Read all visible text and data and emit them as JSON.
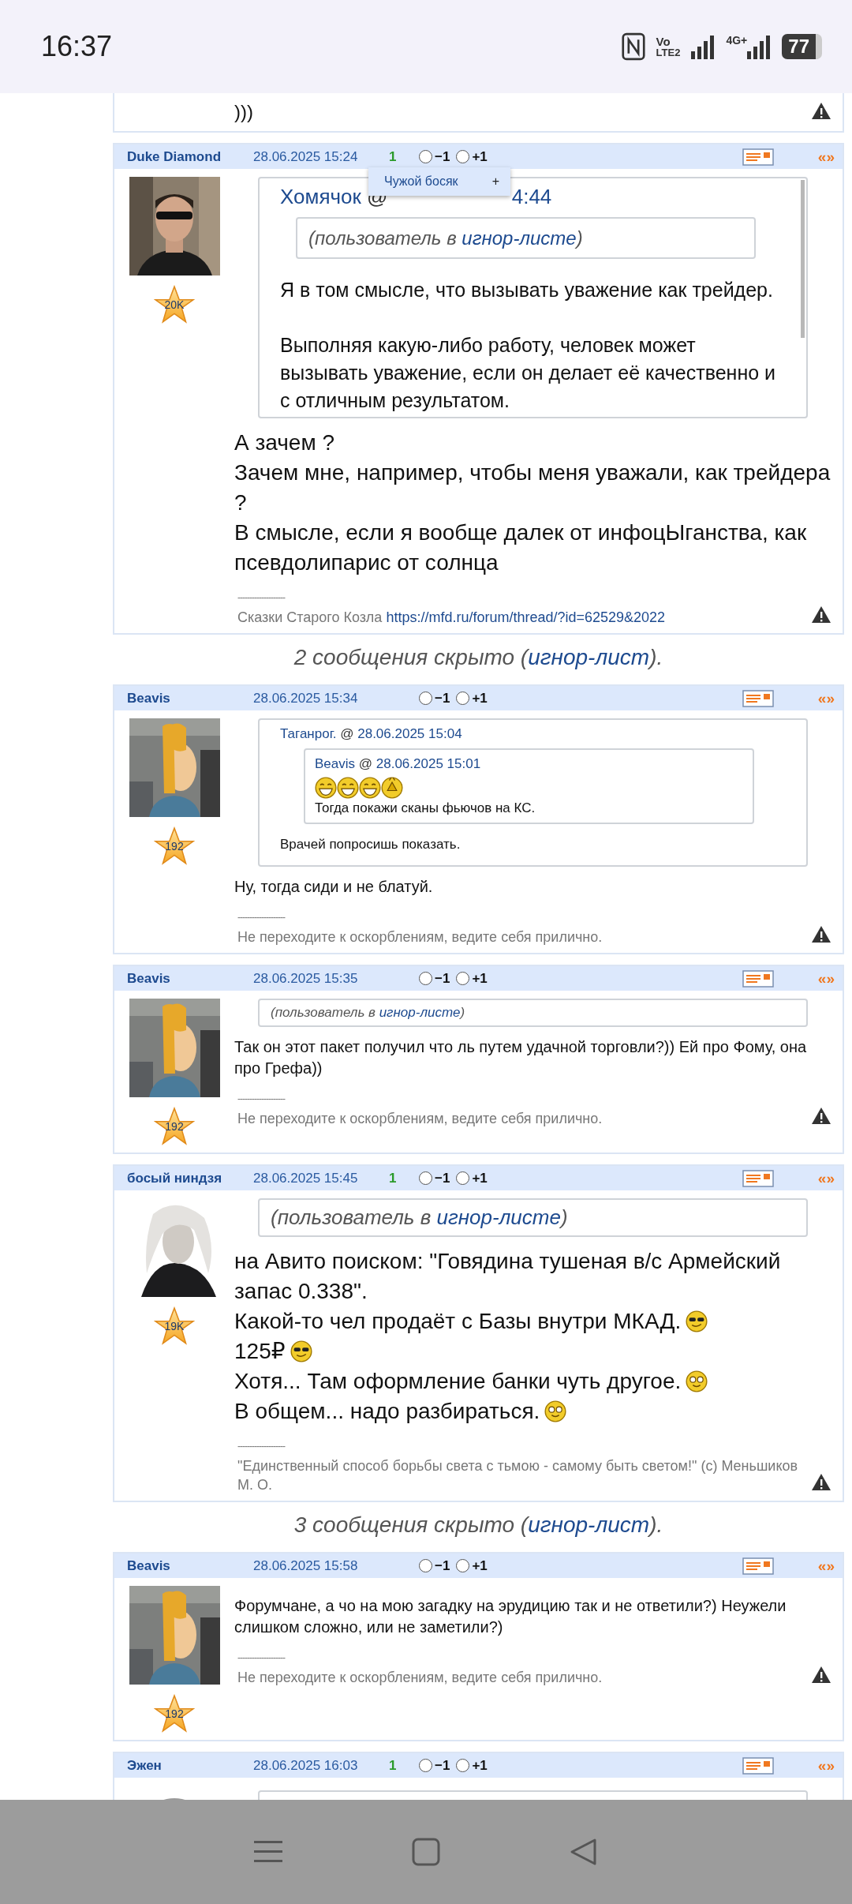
{
  "status_bar": {
    "time": "16:37",
    "call_label": "Vo",
    "call_sub": "LTE2",
    "network": "4G+",
    "battery": "77"
  },
  "items": [
    {
      "kind": "post_tail",
      "text": ")))"
    },
    {
      "kind": "post",
      "author": "Duke Diamond",
      "date": "28.06.2025 15:24",
      "score": "1",
      "votes": [
        {
          "label": "−1",
          "selected": false
        },
        {
          "label": "+1",
          "selected": false
        }
      ],
      "quote_mark": "«»",
      "avatar": {
        "kind": "photo_dark"
      },
      "rating": "20K",
      "large_text": true,
      "popup": {
        "label": "Чужой босяк",
        "action": "+"
      },
      "quote": {
        "author": "Хомячок",
        "separator": "@",
        "date_tail": "4:44",
        "scroll": true,
        "ignored": {
          "pre": "(пользователь в ",
          "link": "игнор-листе",
          "post": ")"
        },
        "paragraphs": [
          "Я в том смысле, что вызывать уважение как трейдер.",
          "Выполняя какую-либо работу, человек может вызывать уважение, если он делает её качественно и с отличным результатом."
        ]
      },
      "lines": [
        {
          "text": "А зачем ?"
        },
        {
          "text": "Зачем мне, например, чтобы меня уважали, как трейдера ?"
        },
        {
          "text": "В смысле, если я вообще далек от инфоцЫганства, как псевдолипарис от солнца"
        }
      ],
      "signature": {
        "rule": "--------------------",
        "text": "Сказки Старого Козла ",
        "link": "https://mfd.ru/forum/thread/?id=62529&2022"
      }
    },
    {
      "kind": "hidden_notice",
      "text": "2 сообщения скрыто (",
      "link": "игнор-лист",
      "tail": ")."
    },
    {
      "kind": "post",
      "author": "Beavis",
      "date": "28.06.2025 15:34",
      "votes": [
        {
          "label": "−1",
          "selected": false
        },
        {
          "label": "+1",
          "selected": false
        }
      ],
      "quote_mark": "«»",
      "avatar": {
        "kind": "cartoon"
      },
      "rating": "192",
      "large_text": false,
      "quote": {
        "author": "Таганрог.",
        "separator": "@",
        "date": "28.06.2025 15:04",
        "quote": {
          "author": "Beavis",
          "separator": "@",
          "date": "28.06.2025 15:01",
          "emojis": [
            {
              "kind": "laugh"
            },
            {
              "kind": "laugh"
            },
            {
              "kind": "laugh"
            },
            {
              "kind": "clap"
            }
          ],
          "paragraphs": [
            "Тогда покажи сканы фьючов на КС."
          ]
        },
        "paragraphs": [
          "Врачей попросишь показать."
        ]
      },
      "lines": [
        {
          "text": "Ну, тогда сиди и не блатуй."
        }
      ],
      "signature": {
        "rule": "--------------------",
        "text": "Не переходите к оскорблениям, ведите себя прилично."
      }
    },
    {
      "kind": "post",
      "author": "Beavis",
      "date": "28.06.2025 15:35",
      "votes": [
        {
          "label": "−1",
          "selected": false
        },
        {
          "label": "+1",
          "selected": false
        }
      ],
      "quote_mark": "«»",
      "avatar": {
        "kind": "cartoon"
      },
      "rating": "192",
      "large_text": false,
      "ignored": {
        "pre": "(пользователь в ",
        "link": "игнор-листе",
        "post": ")"
      },
      "lines": [
        {
          "text": "Так он этот пакет получил что ль путем удачной торговли?)) Ей про Фому, она про Грефа))"
        }
      ],
      "signature": {
        "rule": "--------------------",
        "text": "Не переходите к оскорблениям, ведите себя прилично."
      }
    },
    {
      "kind": "post",
      "author": "босый ниндзя",
      "date": "28.06.2025 15:45",
      "score": "1",
      "votes": [
        {
          "label": "−1",
          "selected": false
        },
        {
          "label": "+1",
          "selected": false
        }
      ],
      "quote_mark": "«»",
      "avatar": {
        "kind": "photo_white"
      },
      "rating": "19K",
      "large_text": true,
      "ignored": {
        "pre": "(пользователь в ",
        "link": "игнор-листе",
        "post": ")"
      },
      "lines": [
        {
          "text": "на Авито поиском: \"Говядина тушеная в/с Армейский запас 0.338\"."
        },
        {
          "text": "Какой-то чел продаёт с Базы внутри МКАД.",
          "emoji": {
            "kind": "cool"
          }
        },
        {
          "text": "125₽",
          "emoji": {
            "kind": "cool"
          }
        },
        {
          "text": "Хотя... Там оформление банки чуть другое.",
          "emoji": {
            "kind": "dizzy"
          }
        },
        {
          "text": "В общем... надо разбираться.",
          "emoji": {
            "kind": "dizzy"
          }
        }
      ],
      "signature": {
        "rule": "--------------------",
        "text": "\"Единственный способ борьбы света с тьмою - самому быть светом!\" (с) Меньшиков М. О."
      }
    },
    {
      "kind": "hidden_notice",
      "text": "3 сообщения скрыто (",
      "link": "игнор-лист",
      "tail": ")."
    },
    {
      "kind": "post",
      "author": "Beavis",
      "date": "28.06.2025 15:58",
      "votes": [
        {
          "label": "−1",
          "selected": false
        },
        {
          "label": "+1",
          "selected": false
        }
      ],
      "quote_mark": "«»",
      "avatar": {
        "kind": "cartoon"
      },
      "rating": "192",
      "large_text": false,
      "lines": [
        {
          "text": "Форумчане, а чо на мою загадку на эрудицию так и не ответили?) Неужели слишком сложно, или не заметили?)"
        }
      ],
      "signature": {
        "rule": "--------------------",
        "text": "Не переходите к оскорблениям, ведите себя прилично."
      }
    },
    {
      "kind": "post_cut",
      "author": "Эжен",
      "date": "28.06.2025 16:03",
      "score": "1",
      "votes": [
        {
          "label": "−1",
          "selected": false
        },
        {
          "label": "+1",
          "selected": false
        }
      ],
      "quote_mark": "«»",
      "avatar": {
        "kind": "blank"
      }
    }
  ]
}
